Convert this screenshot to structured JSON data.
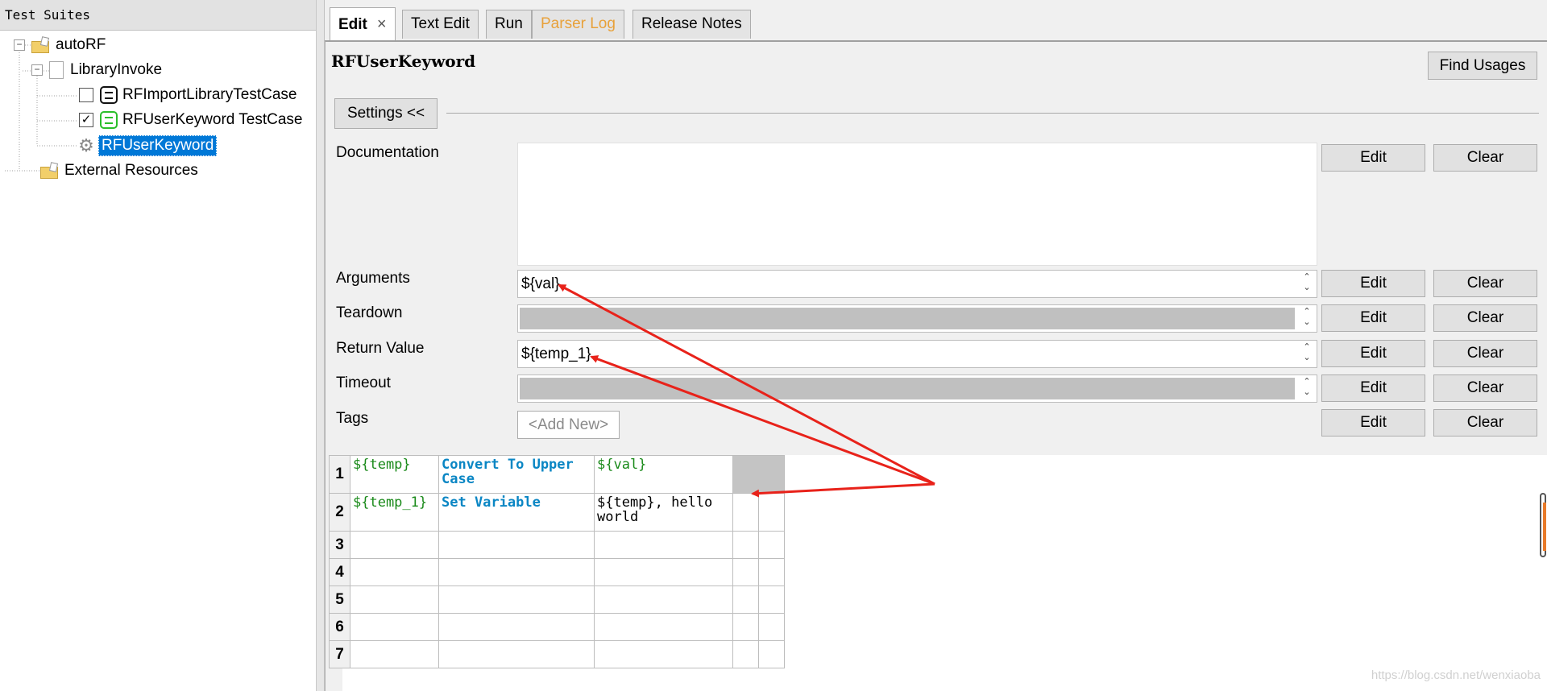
{
  "tree": {
    "header": "Test Suites",
    "items": [
      {
        "label": "autoRF"
      },
      {
        "label": "LibraryInvoke"
      },
      {
        "label": "RFImportLibraryTestCase",
        "checked": false
      },
      {
        "label": "RFUserKeyword TestCase"
      },
      {
        "label": "RFUserKeyword"
      },
      {
        "label": "External Resources"
      }
    ]
  },
  "tabs": [
    {
      "label": "Edit",
      "close": "×"
    },
    {
      "label": "Text Edit"
    },
    {
      "label": "Run"
    },
    {
      "label": "Parser Log"
    },
    {
      "label": "Release Notes"
    }
  ],
  "editor": {
    "title": "RFUserKeyword",
    "find_usages": "Find Usages",
    "settings_button": "Settings <<",
    "fields": {
      "documentation": "Documentation",
      "arguments": "Arguments",
      "arguments_value": "${val}",
      "teardown": "Teardown",
      "return_value": "Return Value",
      "return_value_value": "${temp_1}",
      "timeout": "Timeout",
      "tags": "Tags",
      "add_new": "<Add New>"
    },
    "edit_label": "Edit",
    "clear_label": "Clear"
  },
  "grid": {
    "rows": [
      {
        "num": "1",
        "c1": "${temp}",
        "c2": "Convert To Upper Case",
        "c3": "${val}"
      },
      {
        "num": "2",
        "c1": "${temp_1}",
        "c2": "Set Variable",
        "c3": "${temp}, hello world"
      },
      {
        "num": "3",
        "c1": "",
        "c2": "",
        "c3": ""
      },
      {
        "num": "4",
        "c1": "",
        "c2": "",
        "c3": ""
      },
      {
        "num": "5",
        "c1": "",
        "c2": "",
        "c3": ""
      },
      {
        "num": "6",
        "c1": "",
        "c2": "",
        "c3": ""
      },
      {
        "num": "7",
        "c1": "",
        "c2": "",
        "c3": ""
      }
    ]
  },
  "watermark": "https://blog.csdn.net/wenxiaoba",
  "colors": {
    "selection": "#0078d7",
    "variable": "#1a8a1a",
    "keyword": "#0a86c4",
    "arrow": "#e8221a",
    "warn_tab": "#e8a13a"
  }
}
